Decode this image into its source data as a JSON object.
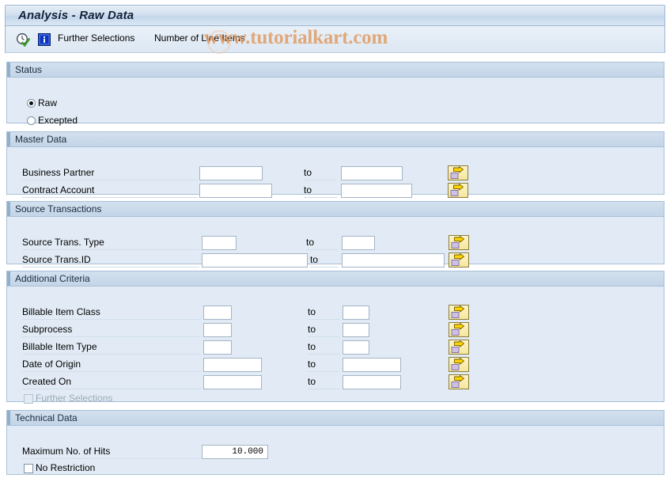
{
  "window": {
    "title": "Analysis - Raw Data"
  },
  "toolbar": {
    "execute_icon": "clock-check-icon",
    "info_icon": "info-icon",
    "further_selections_label": "Further Selections",
    "number_of_line_items_label": "Number of Line Items"
  },
  "watermark": {
    "text": "www.tutorialkart.com",
    "color": "#e09a5f"
  },
  "common": {
    "to_label": "to",
    "multi_select_icon": "multi-select-arrow-icon"
  },
  "sections": {
    "status": {
      "title": "Status",
      "options": [
        {
          "label": "Raw",
          "selected": true
        },
        {
          "label": "Excepted",
          "selected": false
        }
      ]
    },
    "master_data": {
      "title": "Master Data",
      "rows": [
        {
          "label": "Business Partner",
          "from": "",
          "to": ""
        },
        {
          "label": "Contract Account",
          "from": "",
          "to": ""
        }
      ]
    },
    "source_transactions": {
      "title": "Source Transactions",
      "rows": [
        {
          "label": "Source Trans. Type",
          "from": "",
          "to": ""
        },
        {
          "label": "Source Trans.ID",
          "from": "",
          "to": ""
        }
      ]
    },
    "additional_criteria": {
      "title": "Additional Criteria",
      "rows": [
        {
          "label": "Billable Item Class",
          "from": "",
          "to": ""
        },
        {
          "label": "Subprocess",
          "from": "",
          "to": ""
        },
        {
          "label": "Billable Item Type",
          "from": "",
          "to": ""
        },
        {
          "label": "Date of Origin",
          "from": "",
          "to": ""
        },
        {
          "label": "Created On",
          "from": "",
          "to": ""
        }
      ],
      "further_selections": {
        "label": "Further Selections",
        "checked": false,
        "disabled": true
      }
    },
    "technical_data": {
      "title": "Technical Data",
      "max_hits": {
        "label": "Maximum No. of Hits",
        "value": "10.000"
      },
      "no_restriction": {
        "label": "No Restriction",
        "checked": false
      }
    }
  }
}
